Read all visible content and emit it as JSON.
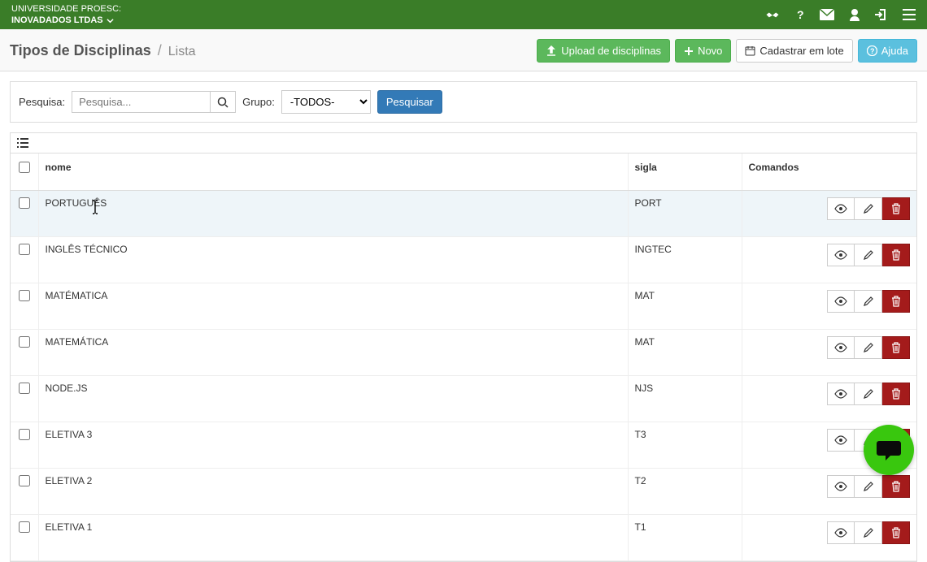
{
  "header": {
    "university": "UNIVERSIDADE PROESC:",
    "org": "INOVADADOS LTDAS"
  },
  "page": {
    "title": "Tipos de Disciplinas",
    "subtitle": "Lista"
  },
  "actions": {
    "upload": "Upload de disciplinas",
    "new": "Novo",
    "batch": "Cadastrar em lote",
    "help": "Ajuda"
  },
  "search": {
    "label": "Pesquisa:",
    "placeholder": "Pesquisa...",
    "group_label": "Grupo:",
    "group_value": "-TODOS-",
    "submit": "Pesquisar"
  },
  "table": {
    "headers": {
      "nome": "nome",
      "sigla": "sigla",
      "comandos": "Comandos"
    },
    "rows": [
      {
        "nome": "PORTUGUÊS",
        "sigla": "PORT",
        "highlight": true
      },
      {
        "nome": "INGLÊS TÉCNICO",
        "sigla": "INGTEC"
      },
      {
        "nome": "MATÉMATICA",
        "sigla": "MAT"
      },
      {
        "nome": "MATEMÁTICA",
        "sigla": "MAT"
      },
      {
        "nome": "NODE.JS",
        "sigla": "NJS"
      },
      {
        "nome": "ELETIVA 3",
        "sigla": "T3"
      },
      {
        "nome": "ELETIVA 2",
        "sigla": "T2"
      },
      {
        "nome": "ELETIVA 1",
        "sigla": "T1"
      }
    ]
  }
}
